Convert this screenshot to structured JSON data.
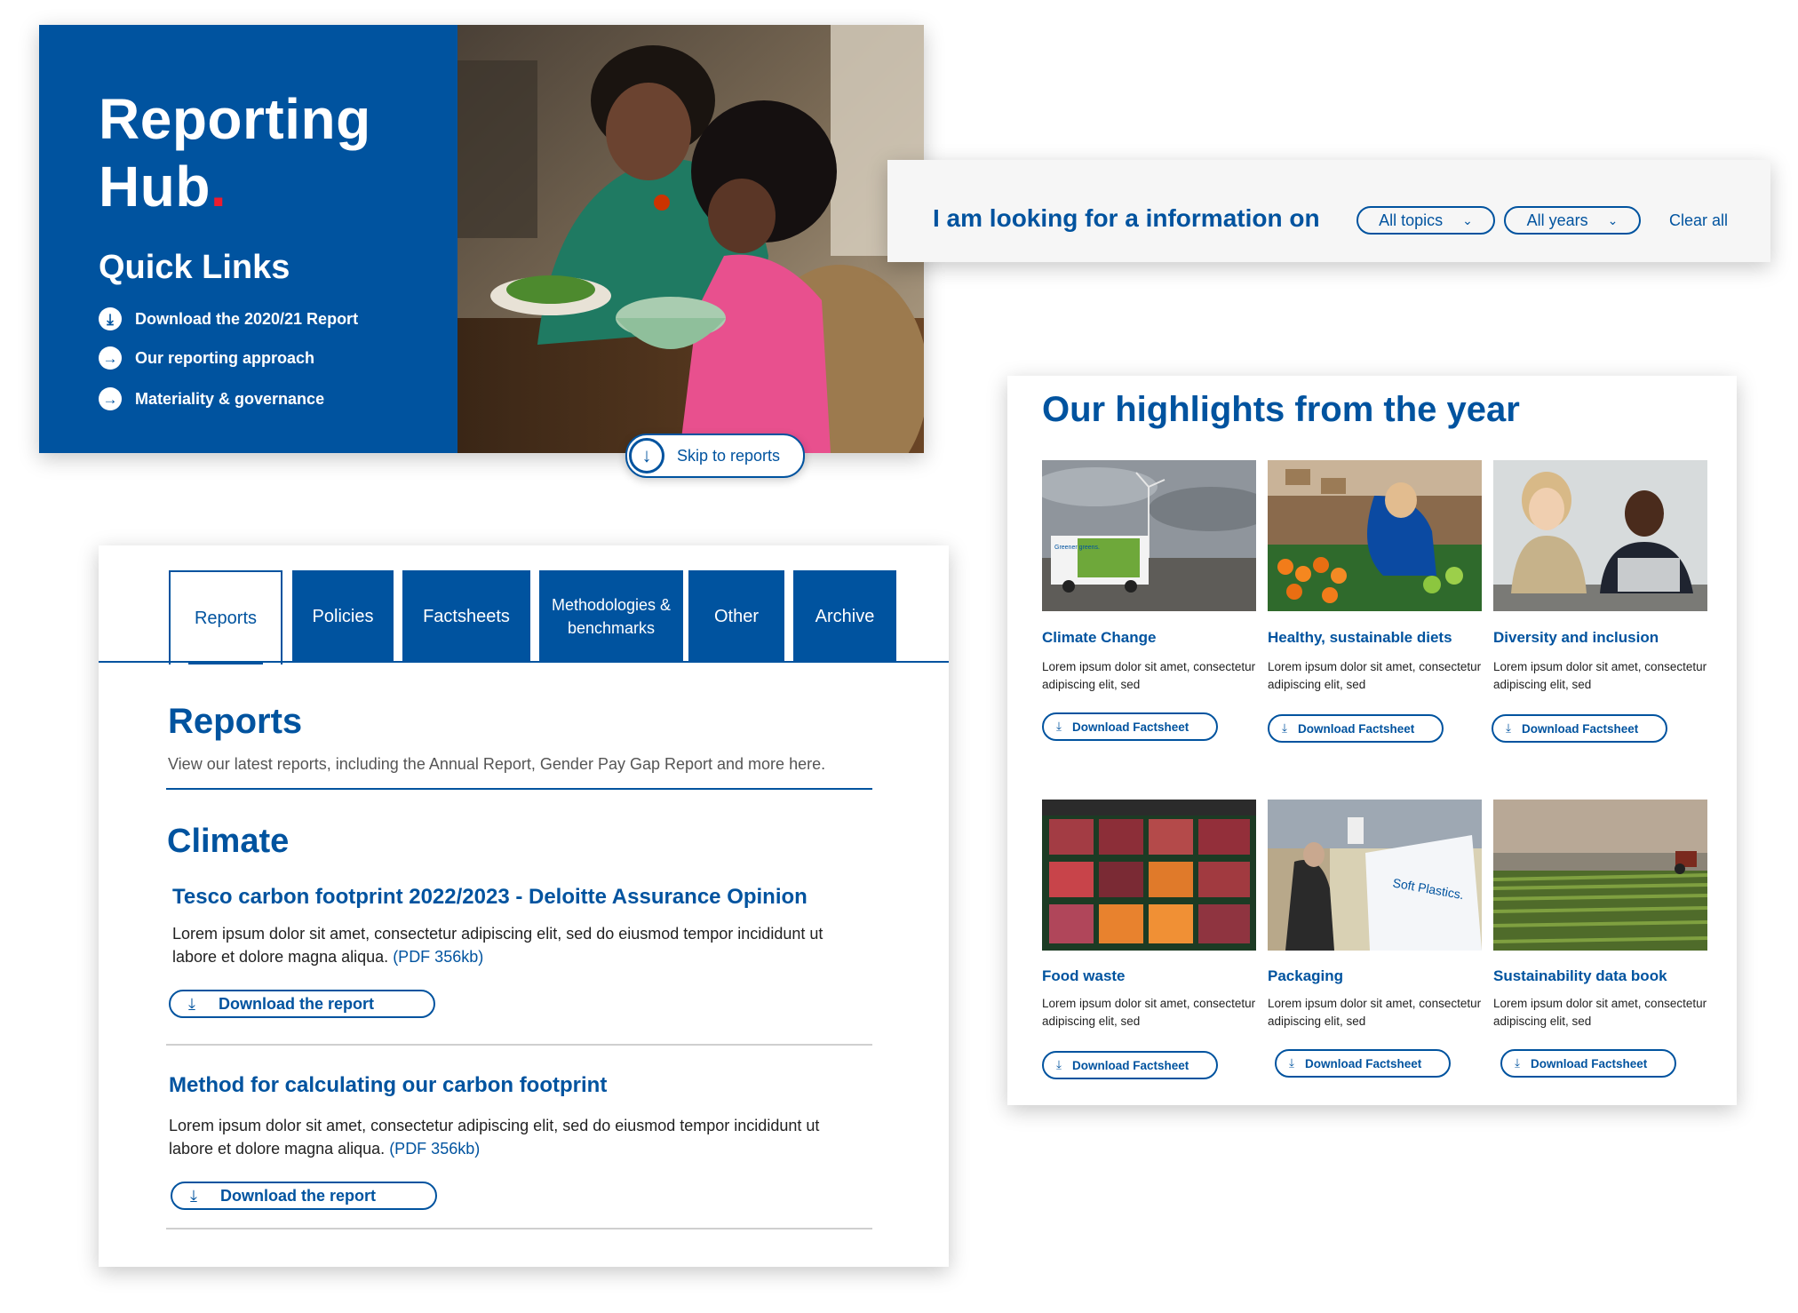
{
  "hero": {
    "title_line1": "Reporting",
    "title_line2": "Hub",
    "title_dot": ".",
    "quick_links_title": "Quick Links",
    "quick_links": [
      {
        "label": "Download the 2020/21 Report",
        "icon": "download-icon"
      },
      {
        "label": "Our reporting approach",
        "icon": "arrow-right-icon"
      },
      {
        "label": "Materiality & governance",
        "icon": "arrow-right-icon"
      }
    ],
    "skip_label": "Skip to reports",
    "brand_color": "#00539f",
    "accent_color": "#ee1c2e"
  },
  "filter": {
    "label": "I am looking for a information on",
    "topics": "All topics",
    "years": "All years",
    "clear": "Clear all"
  },
  "reports_panel": {
    "tabs": [
      {
        "label": "Reports",
        "active": true
      },
      {
        "label": "Policies"
      },
      {
        "label": "Factsheets"
      },
      {
        "label": "Methodologies & benchmarks"
      },
      {
        "label": "Other"
      },
      {
        "label": "Archive"
      }
    ],
    "title": "Reports",
    "subtitle": "View our latest reports, including the Annual Report, Gender Pay Gap Report and more here.",
    "section_title": "Climate",
    "items": [
      {
        "title": "Tesco carbon footprint 2022/2023 - Deloitte Assurance Opinion",
        "body": "Lorem ipsum dolor sit amet, consectetur adipiscing elit, sed do eiusmod tempor incididunt ut labore et dolore magna aliqua.",
        "pdf": "(PDF 356kb)",
        "button": "Download the report"
      },
      {
        "title": "Method for calculating our carbon footprint",
        "body": "Lorem ipsum dolor sit amet, consectetur adipiscing elit, sed do eiusmod tempor incididunt ut labore et dolore magna aliqua.",
        "pdf": "(PDF 356kb)",
        "button": "Download the report"
      }
    ]
  },
  "highlights": {
    "title": "Our highlights from the year",
    "cards": [
      {
        "name": "Climate Change",
        "text": "Lorem ipsum dolor sit amet, consectetur adipiscing elit, sed",
        "button": "Download Factsheet"
      },
      {
        "name": "Healthy, sustainable diets",
        "text": "Lorem ipsum dolor sit amet, consectetur adipiscing elit, sed",
        "button": "Download Factsheet"
      },
      {
        "name": "Diversity and inclusion",
        "text": "Lorem ipsum dolor sit amet, consectetur adipiscing elit, sed",
        "button": "Download Factsheet"
      },
      {
        "name": "Food waste",
        "text": "Lorem ipsum dolor sit amet, consectetur adipiscing elit, sed",
        "button": "Download Factsheet"
      },
      {
        "name": "Packaging",
        "text": "Lorem ipsum dolor sit amet, consectetur adipiscing elit, sed",
        "button": "Download Factsheet"
      },
      {
        "name": "Sustainability data book",
        "text": "Lorem ipsum dolor sit amet, consectetur adipiscing elit, sed",
        "button": "Download Factsheet"
      }
    ],
    "van_text": "Greener greens.",
    "bag_text": "Soft Plastics."
  }
}
